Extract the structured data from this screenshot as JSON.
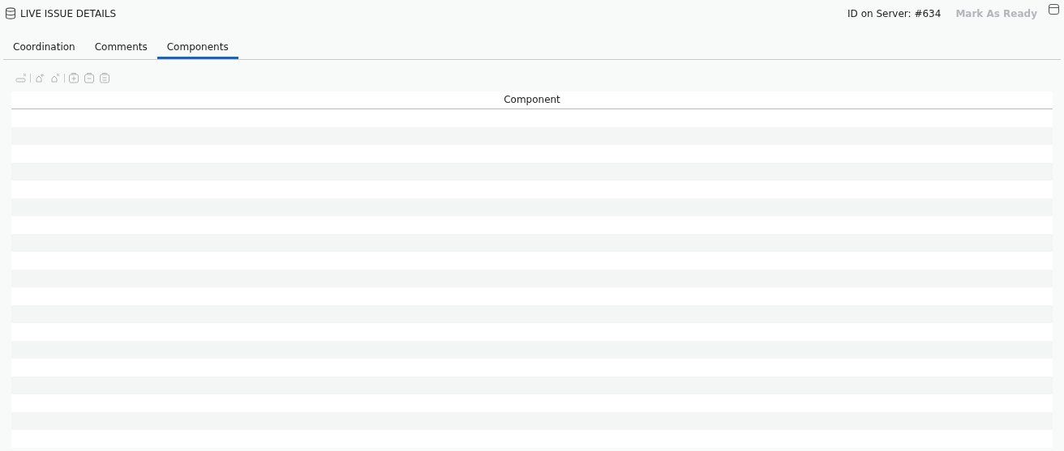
{
  "panel": {
    "title": "LIVE ISSUE DETAILS",
    "server_id": "ID on Server: #634",
    "mark_ready": {
      "label": "Mark As Ready",
      "disabled": true
    }
  },
  "tabs": [
    {
      "label": "Coordination",
      "selected": false
    },
    {
      "label": "Comments",
      "selected": false
    },
    {
      "label": "Components",
      "selected": true
    }
  ],
  "toolbar": {
    "disabled": true
  },
  "table": {
    "columns": [
      "Component"
    ]
  }
}
